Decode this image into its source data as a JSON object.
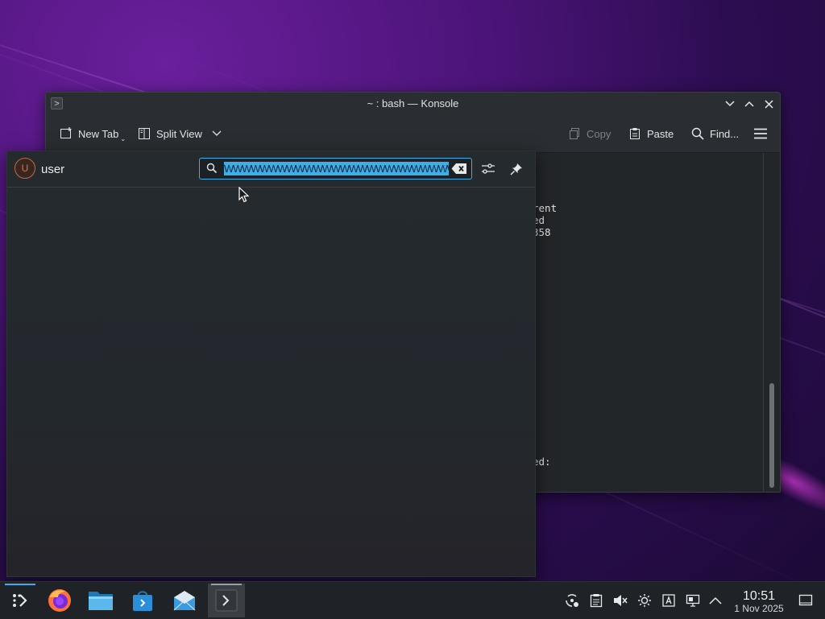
{
  "window": {
    "title": "~ : bash — Konsole",
    "app_icon_glyph": ">",
    "toolbar": {
      "new_tab": "New Tab",
      "split_view": "Split View",
      "copy": "Copy",
      "paste": "Paste",
      "find": "Find..."
    },
    "terminal_lines": [
      "rent",
      "ed",
      "358",
      "ed:"
    ]
  },
  "launcher": {
    "username": "user",
    "avatar_letter": "U",
    "search_value": "WWWWWWWWWWWWWWWWWWWWWWWWWWWWWWWWWWWWW",
    "accent_color": "#3daee9"
  },
  "taskbar": {
    "apps": [
      "application-launcher-icon",
      "firefox-icon",
      "file-manager-icon",
      "discover-store-icon",
      "mail-client-icon",
      "konsole-icon"
    ],
    "tray": [
      "network-icon",
      "clipboard-icon",
      "volume-muted-icon",
      "brightness-icon",
      "keyboard-layout-icon",
      "display-icon",
      "expand-tray-icon"
    ],
    "clock": {
      "time": "10:51",
      "date": "1 Nov 2025"
    }
  }
}
